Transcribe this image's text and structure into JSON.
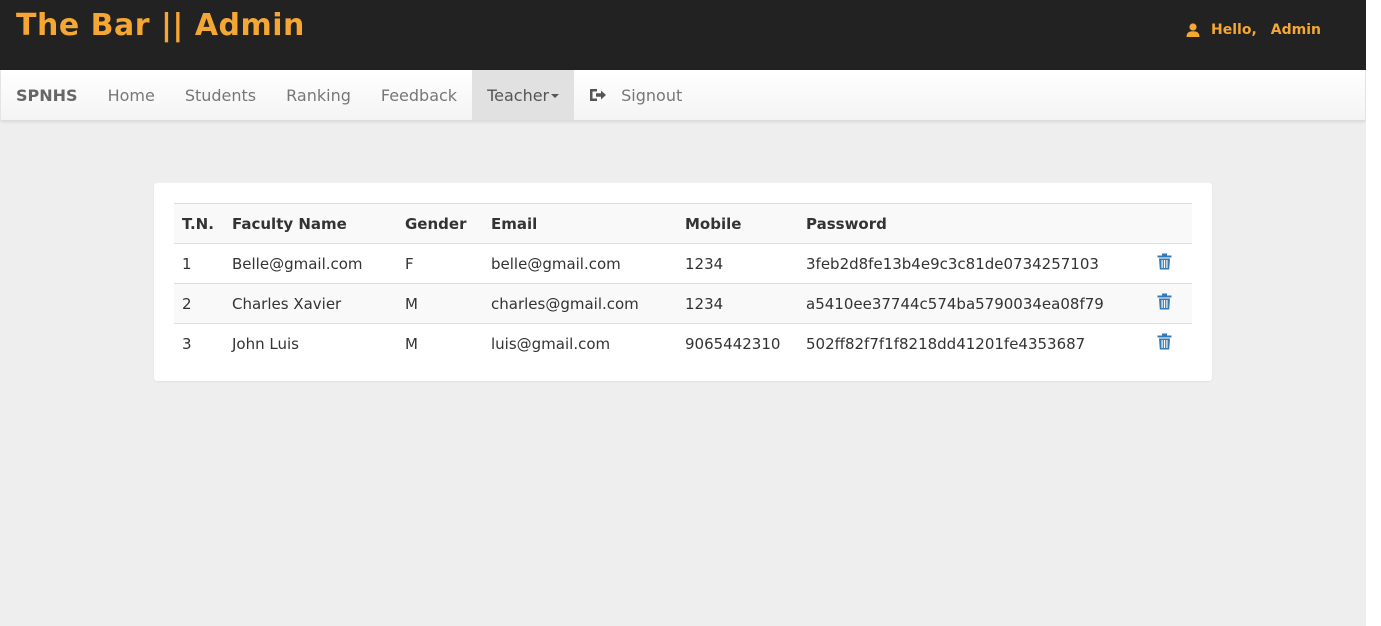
{
  "header": {
    "title": "The Bar || Admin",
    "greeting": "Hello,",
    "user_name": "Admin",
    "user_icon": "user-icon",
    "accent_color": "#f4a733",
    "background_color": "#222222"
  },
  "navbar": {
    "brand": "SPNHS",
    "items": [
      {
        "label": "Home"
      },
      {
        "label": "Students"
      },
      {
        "label": "Ranking"
      },
      {
        "label": "Feedback"
      },
      {
        "label": "Teacher",
        "active": true,
        "dropdown": true
      },
      {
        "label": "Signout",
        "icon": "signout-icon"
      }
    ]
  },
  "table": {
    "columns": [
      "T.N.",
      "Faculty Name",
      "Gender",
      "Email",
      "Mobile",
      "Password"
    ],
    "rows": [
      {
        "tn": "1",
        "name": "Belle@gmail.com",
        "gender": "F",
        "email": "belle@gmail.com",
        "mobile": "1234",
        "password": "3feb2d8fe13b4e9c3c81de0734257103",
        "action_icon": "trash-icon"
      },
      {
        "tn": "2",
        "name": "Charles Xavier",
        "gender": "M",
        "email": "charles@gmail.com",
        "mobile": "1234",
        "password": "a5410ee37744c574ba5790034ea08f79",
        "action_icon": "trash-icon"
      },
      {
        "tn": "3",
        "name": "John Luis",
        "gender": "M",
        "email": "luis@gmail.com",
        "mobile": "9065442310",
        "password": "502ff82f7f1f8218dd41201fe4353687",
        "action_icon": "trash-icon"
      }
    ],
    "icon_color": "#337ab7"
  }
}
